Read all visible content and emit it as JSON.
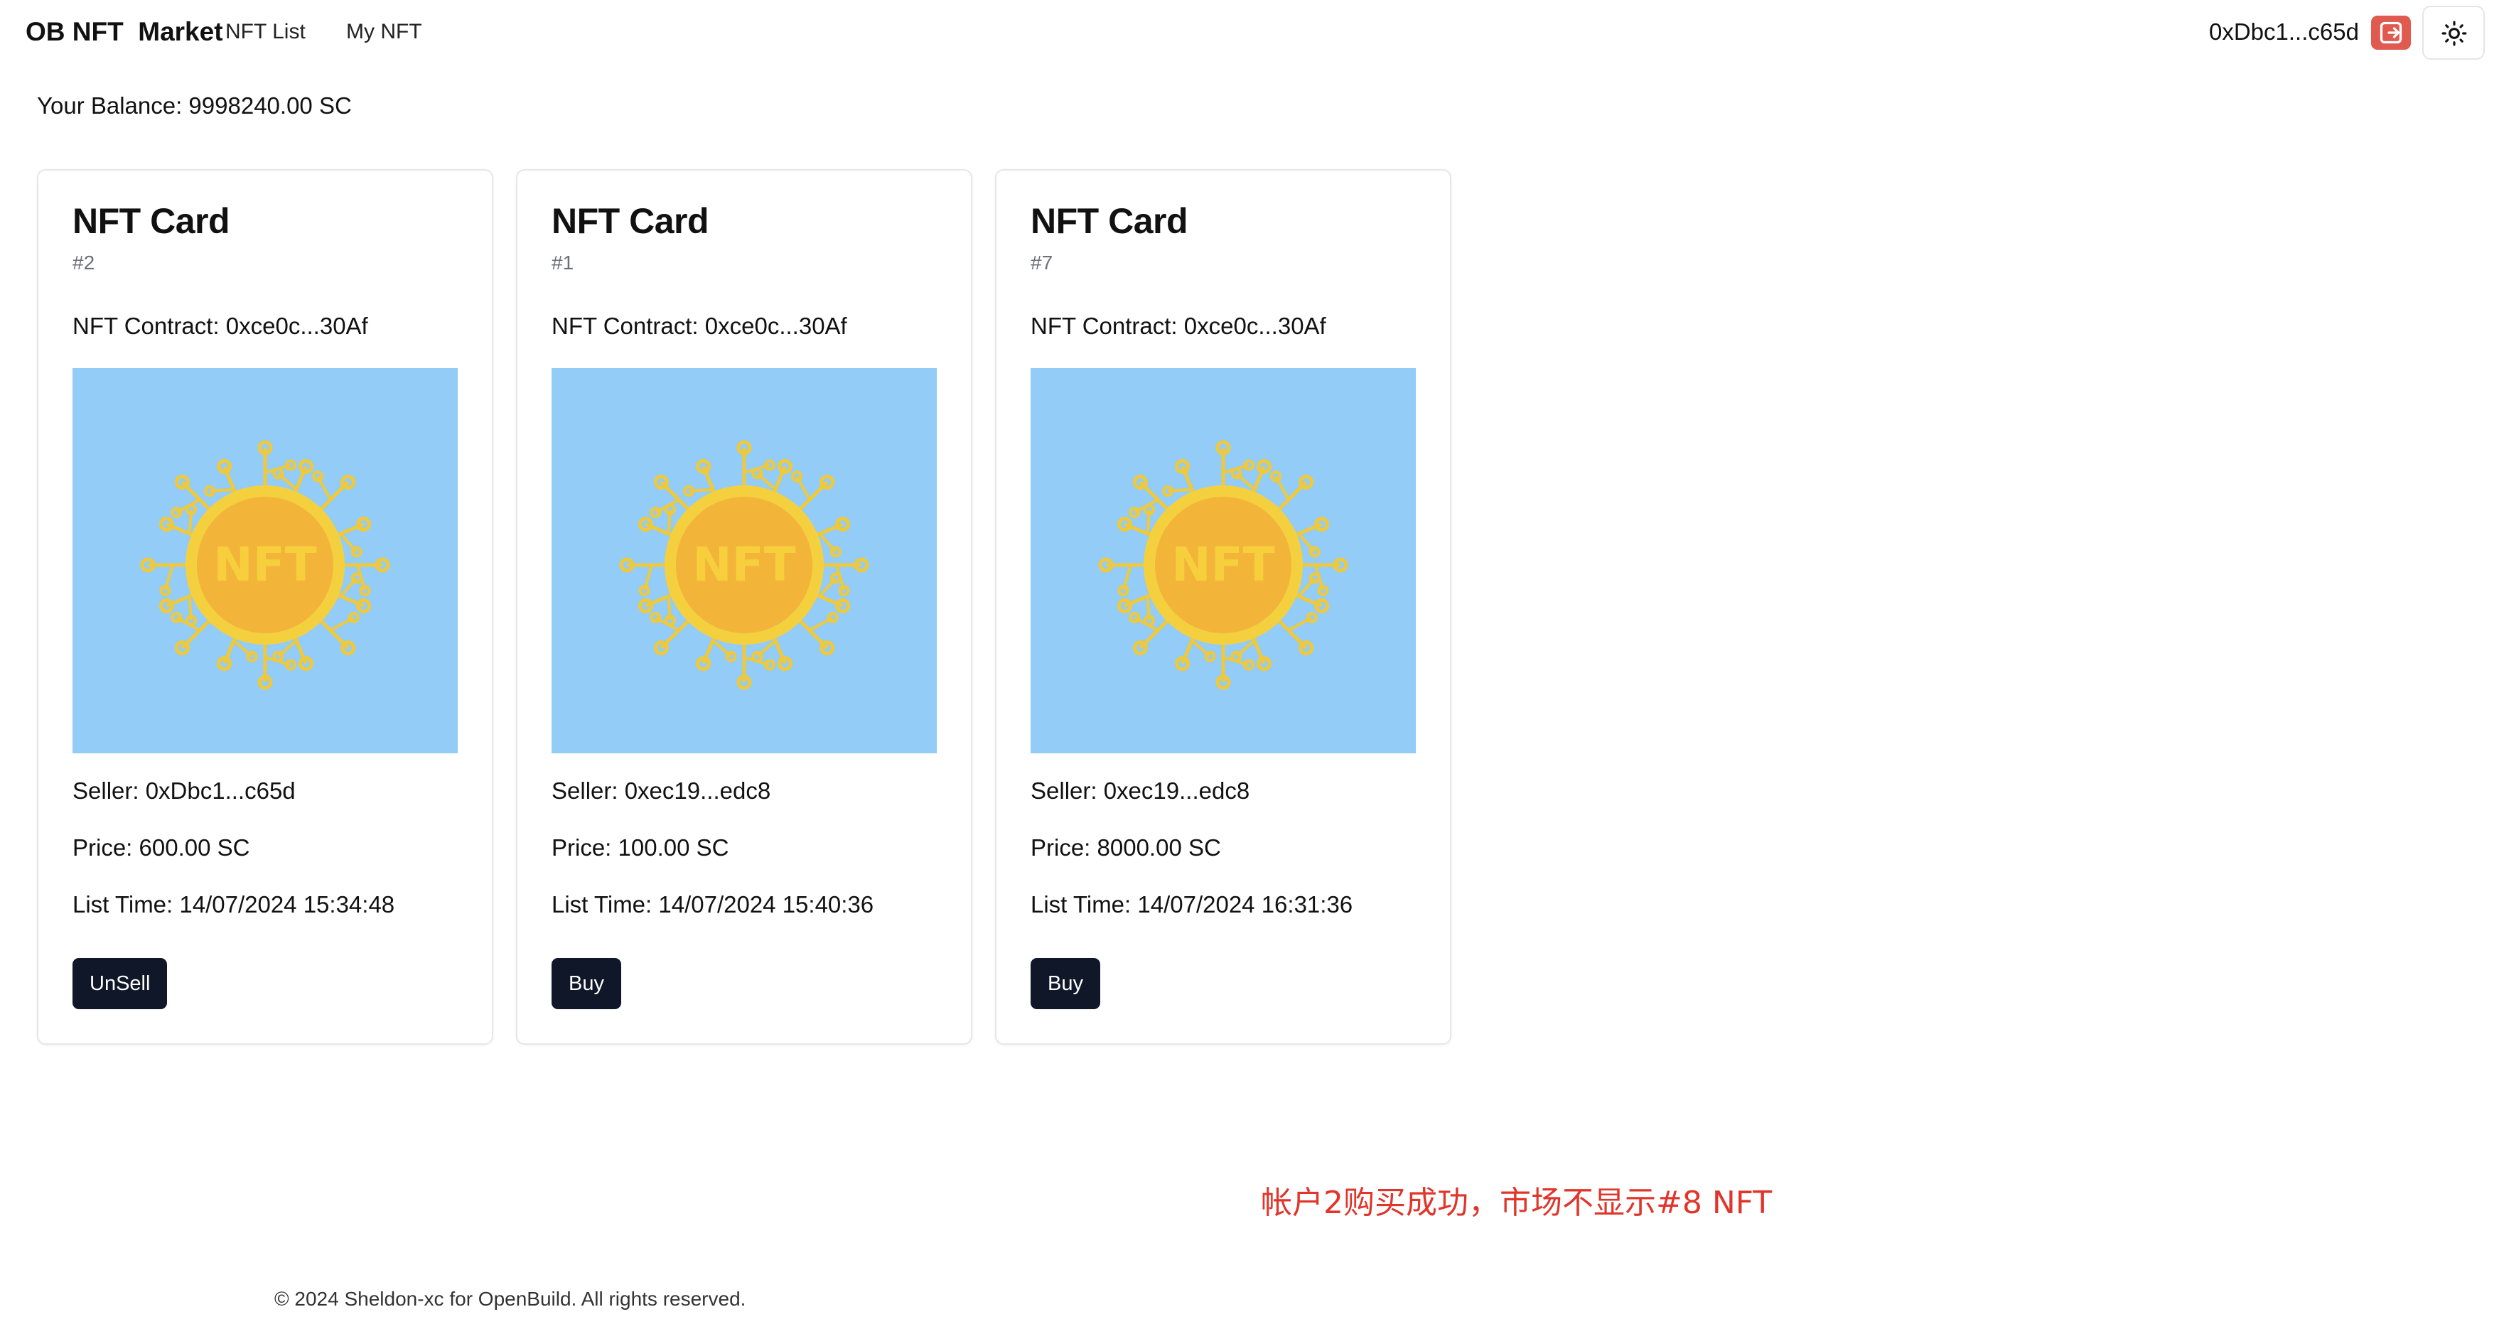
{
  "header": {
    "brand": "OB NFT  Market",
    "nav": [
      {
        "label": "NFT List"
      },
      {
        "label": "My NFT"
      }
    ],
    "account": "0xDbc1...c65d",
    "icons": {
      "logout": "logout-icon",
      "theme": "sun-icon"
    },
    "colors": {
      "logout_bg": "#e05a4f"
    }
  },
  "balance": "Your Balance: 9998240.00 SC",
  "cards": [
    {
      "title": "NFT Card",
      "id": "#2",
      "contract": "NFT Contract: 0xce0c...30Af",
      "image_text": "NFT",
      "seller": "Seller: 0xDbc1...c65d",
      "price": "Price: 600.00 SC",
      "list_time": "List Time: 14/07/2024 15:34:48",
      "action": "UnSell"
    },
    {
      "title": "NFT Card",
      "id": "#1",
      "contract": "NFT Contract: 0xce0c...30Af",
      "image_text": "NFT",
      "seller": "Seller: 0xec19...edc8",
      "price": "Price: 100.00 SC",
      "list_time": "List Time: 14/07/2024 15:40:36",
      "action": "Buy"
    },
    {
      "title": "NFT Card",
      "id": "#7",
      "contract": "NFT Contract: 0xce0c...30Af",
      "image_text": "NFT",
      "seller": "Seller: 0xec19...edc8",
      "price": "Price: 8000.00 SC",
      "list_time": "List Time: 14/07/2024 16:31:36",
      "action": "Buy"
    }
  ],
  "annotation": "帐户2购买成功，市场不显示#8 NFT",
  "footer": "© 2024 Sheldon-xc for OpenBuild. All rights reserved.",
  "colors": {
    "image_bg": "#93ccf6",
    "coin_outer": "#f4d03f",
    "coin_inner": "#f2b53a",
    "button_bg": "#0f1729",
    "annotation": "#e0352b"
  }
}
